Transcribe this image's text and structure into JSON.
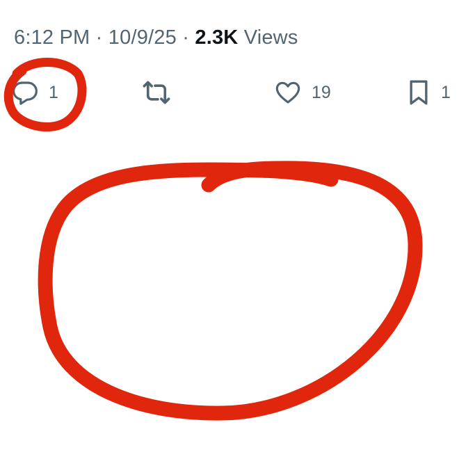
{
  "post_meta": {
    "time": "6:12 PM",
    "date": "10/9/25",
    "separator": "·",
    "views_count": "2.3K",
    "views_label": "Views"
  },
  "actions": {
    "reply": {
      "icon": "reply-icon",
      "count": "1"
    },
    "repost": {
      "icon": "repost-icon",
      "count": ""
    },
    "like": {
      "icon": "heart-icon",
      "count": "19"
    },
    "bookmark": {
      "icon": "bookmark-icon",
      "count": "1"
    }
  },
  "colors": {
    "meta_text": "#536471",
    "emphasis_text": "#0f1419",
    "annotation_red": "#e0260c"
  }
}
